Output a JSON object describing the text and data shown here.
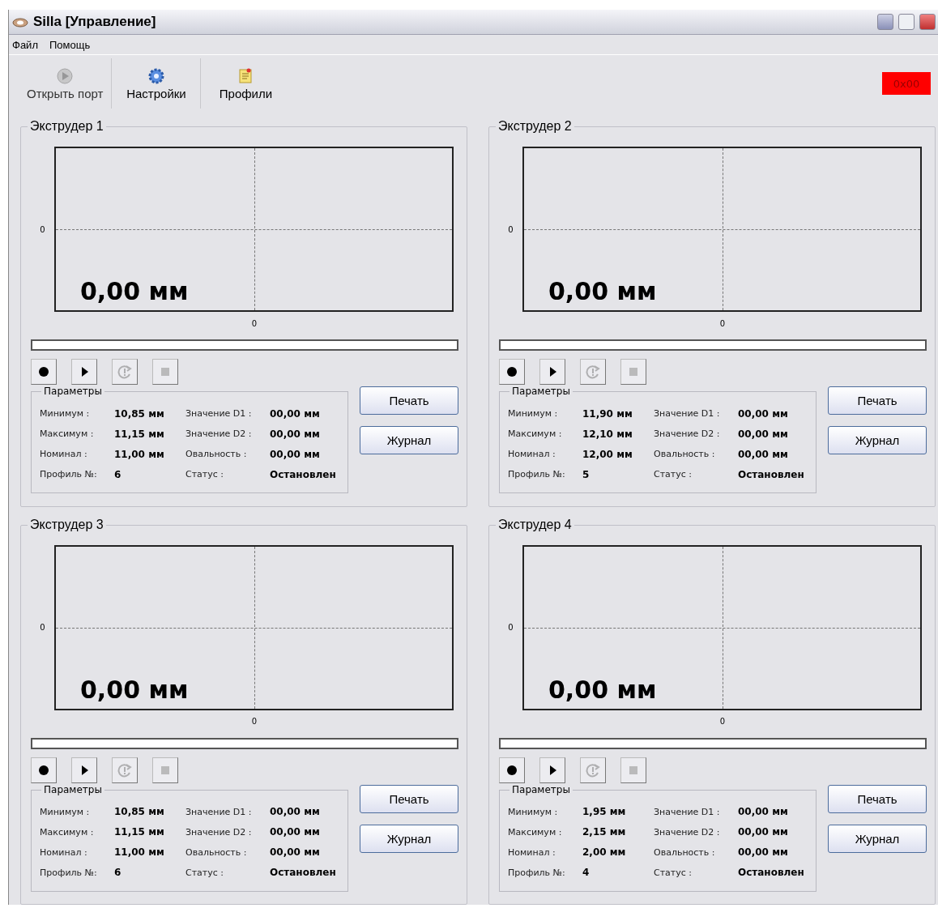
{
  "window": {
    "title": "Silla [Управление]"
  },
  "menu": [
    "Файл",
    "Помощь"
  ],
  "toolbar": [
    {
      "kind": "port",
      "label": "Открыть порт",
      "disabled": true
    },
    {
      "kind": "settings",
      "label": "Настройки",
      "disabled": false
    },
    {
      "kind": "profiles",
      "label": "Профили",
      "disabled": false
    }
  ],
  "indicator": {
    "text": "0x00",
    "color": "#ff0000"
  },
  "extruders": [
    {
      "title": "Экструдер 1",
      "reading": "0,00 мм",
      "y_tick": "0",
      "x_tick": "0",
      "progress": {
        "level": 0
      },
      "controls": [
        {
          "kind": "record",
          "disabled": false
        },
        {
          "kind": "play",
          "disabled": false
        },
        {
          "kind": "refresh",
          "disabled": true
        },
        {
          "kind": "stop",
          "disabled": true
        }
      ],
      "params": {
        "title": "Параметры",
        "rows": [
          {
            "label": "Минимум :",
            "value": "10,85 мм",
            "label2": "Значение D1 :",
            "value2": "00,00 мм"
          },
          {
            "label": "Максимум :",
            "value": "11,15 мм",
            "label2": "Значение D2 :",
            "value2": "00,00 мм"
          },
          {
            "label": "Номинал :",
            "value": "11,00 мм",
            "label2": "Овальность :",
            "value2": "00,00 мм"
          },
          {
            "label": "Профиль №:",
            "value": "6",
            "label2": "Статус :",
            "value2": "Остановлен"
          }
        ]
      },
      "buttons": [
        "Печать",
        "Журнал"
      ]
    },
    {
      "title": "Экструдер 2",
      "reading": "0,00 мм",
      "y_tick": "0",
      "x_tick": "0",
      "progress": {
        "level": 0
      },
      "controls": [
        {
          "kind": "record",
          "disabled": false
        },
        {
          "kind": "play",
          "disabled": false
        },
        {
          "kind": "refresh",
          "disabled": true
        },
        {
          "kind": "stop",
          "disabled": true
        }
      ],
      "params": {
        "title": "Параметры",
        "rows": [
          {
            "label": "Минимум :",
            "value": "11,90 мм",
            "label2": "Значение D1 :",
            "value2": "00,00 мм"
          },
          {
            "label": "Максимум :",
            "value": "12,10 мм",
            "label2": "Значение D2 :",
            "value2": "00,00 мм"
          },
          {
            "label": "Номинал :",
            "value": "12,00 мм",
            "label2": "Овальность :",
            "value2": "00,00 мм"
          },
          {
            "label": "Профиль №:",
            "value": "5",
            "label2": "Статус :",
            "value2": "Остановлен"
          }
        ]
      },
      "buttons": [
        "Печать",
        "Журнал"
      ]
    },
    {
      "title": "Экструдер 3",
      "reading": "0,00 мм",
      "y_tick": "0",
      "x_tick": "0",
      "progress": {
        "level": 0
      },
      "controls": [
        {
          "kind": "record",
          "disabled": false
        },
        {
          "kind": "play",
          "disabled": false
        },
        {
          "kind": "refresh",
          "disabled": true
        },
        {
          "kind": "stop",
          "disabled": true
        }
      ],
      "params": {
        "title": "Параметры",
        "rows": [
          {
            "label": "Минимум :",
            "value": "10,85 мм",
            "label2": "Значение D1 :",
            "value2": "00,00 мм"
          },
          {
            "label": "Максимум :",
            "value": "11,15 мм",
            "label2": "Значение D2 :",
            "value2": "00,00 мм"
          },
          {
            "label": "Номинал :",
            "value": "11,00 мм",
            "label2": "Овальность :",
            "value2": "00,00 мм"
          },
          {
            "label": "Профиль №:",
            "value": "6",
            "label2": "Статус :",
            "value2": "Остановлен"
          }
        ]
      },
      "buttons": [
        "Печать",
        "Журнал"
      ]
    },
    {
      "title": "Экструдер 4",
      "reading": "0,00 мм",
      "y_tick": "0",
      "x_tick": "0",
      "progress": {
        "level": 0
      },
      "controls": [
        {
          "kind": "record",
          "disabled": false
        },
        {
          "kind": "play",
          "disabled": false
        },
        {
          "kind": "refresh",
          "disabled": true
        },
        {
          "kind": "stop",
          "disabled": true
        }
      ],
      "params": {
        "title": "Параметры",
        "rows": [
          {
            "label": "Минимум :",
            "value": "1,95 мм",
            "label2": "Значение D1 :",
            "value2": "00,00 мм"
          },
          {
            "label": "Максимум :",
            "value": "2,15 мм",
            "label2": "Значение D2 :",
            "value2": "00,00 мм"
          },
          {
            "label": "Номинал :",
            "value": "2,00 мм",
            "label2": "Овальность :",
            "value2": "00,00 мм"
          },
          {
            "label": "Профиль №:",
            "value": "4",
            "label2": "Статус :",
            "value2": "Остановлен"
          }
        ]
      },
      "buttons": [
        "Печать",
        "Журнал"
      ]
    }
  ]
}
